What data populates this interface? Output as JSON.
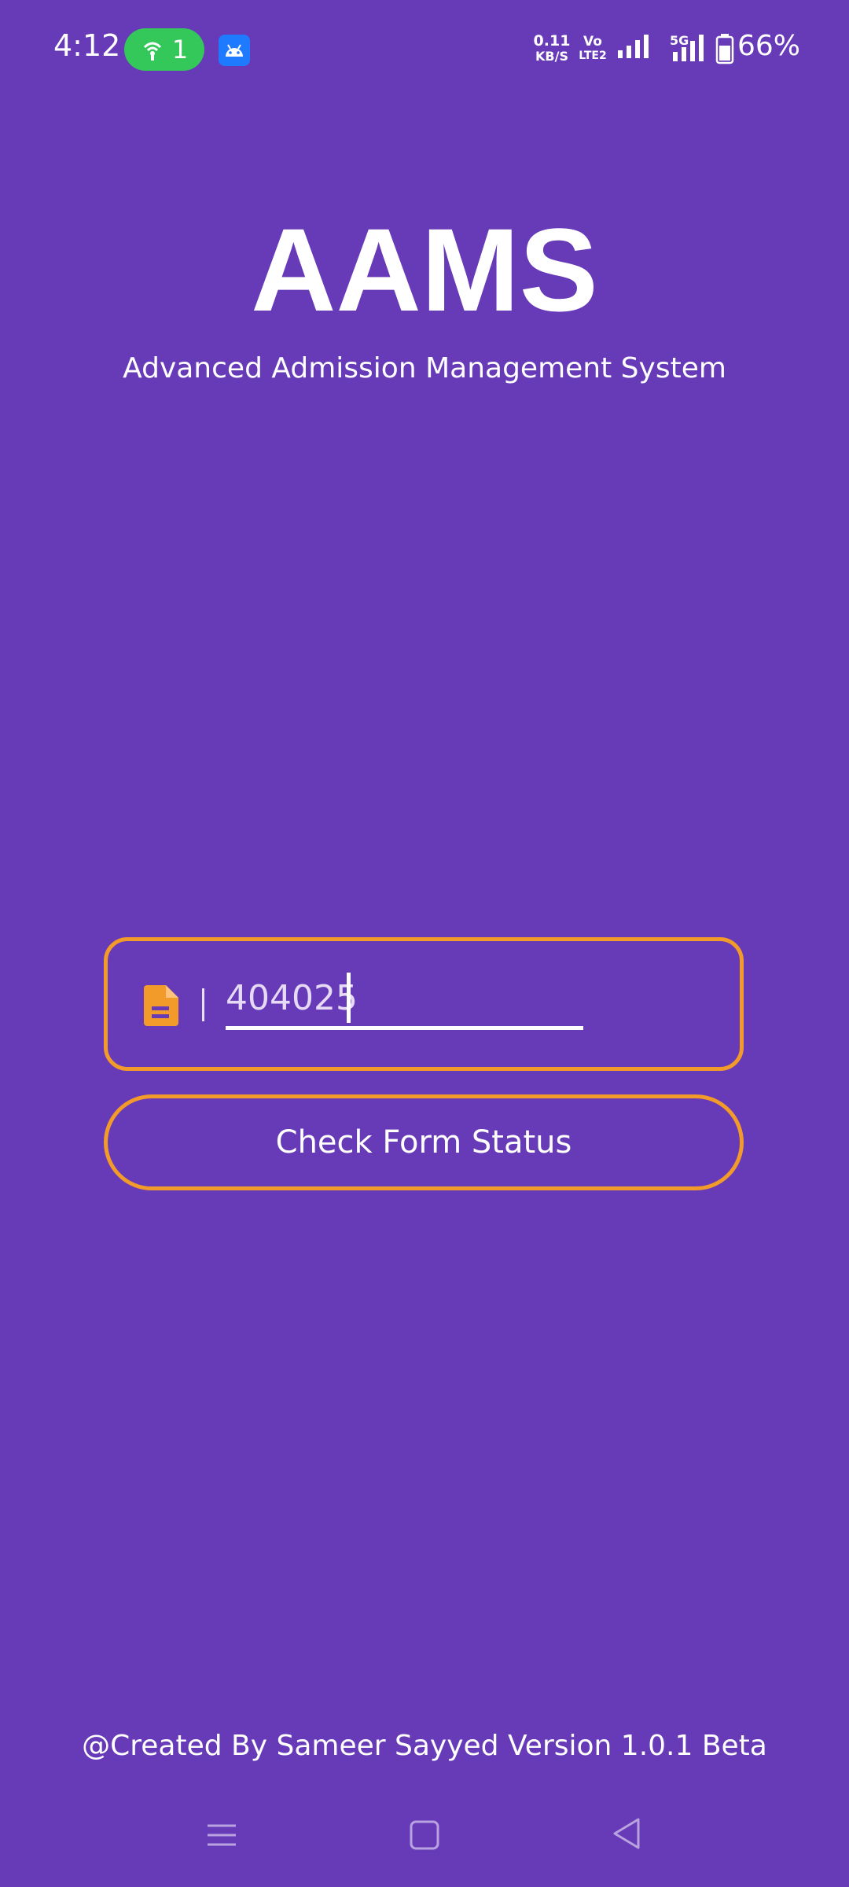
{
  "status_bar": {
    "time": "4:12",
    "hotspot_count": "1",
    "net_speed_value": "0.11",
    "net_speed_unit": "KB/S",
    "volte_top": "Vo",
    "volte_bottom": "LTE2",
    "network_type": "5G",
    "battery": "66%",
    "icons": [
      "hotspot-icon",
      "android-icon",
      "signal-icon",
      "signal-5g-icon",
      "battery-icon"
    ]
  },
  "header": {
    "title": "AAMS",
    "subtitle": "Advanced Admission Management System"
  },
  "form": {
    "input_value": "404025",
    "field_icon": "document-icon",
    "button_label": "Check Form Status"
  },
  "footer": {
    "credit": "@Created By Sameer Sayyed Version 1.0.1 Beta"
  },
  "nav": {
    "icons": [
      "menu-icon",
      "home-icon",
      "back-icon"
    ]
  },
  "colors": {
    "background": "#673AB7",
    "accent": "#F39B2A",
    "hotspot_pill": "#34C759",
    "text": "#FFFFFF"
  }
}
